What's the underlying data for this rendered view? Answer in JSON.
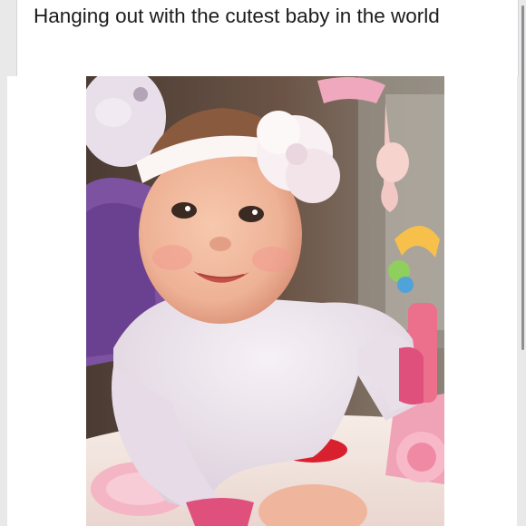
{
  "post": {
    "caption": "Hanging out with the cutest baby in the world"
  },
  "photo": {
    "icon": "baby-photo",
    "colors": {
      "background": "#6f5f4f",
      "skin": "#efb79d",
      "sweater": "#ece4ee",
      "cuff": "#e0507c",
      "headband": "#fbf6f4",
      "seat": "#7d52a0",
      "toy": "#e4243c"
    }
  },
  "ui": {
    "scrollbar_color": "#8e8e92"
  }
}
